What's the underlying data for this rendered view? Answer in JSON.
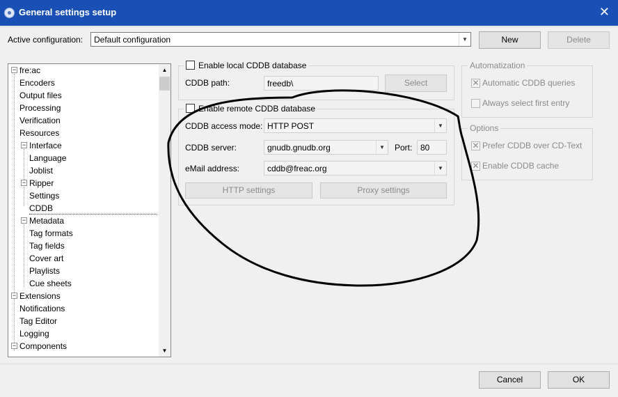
{
  "window": {
    "title": "General settings setup",
    "close_glyph": "✕",
    "icon": "freac-app-icon"
  },
  "top_bar": {
    "active_config_label": "Active configuration:",
    "active_config_value": "Default configuration",
    "new_label": "New",
    "delete_label": "Delete"
  },
  "tree": {
    "items": [
      {
        "label": "fre:ac",
        "expander": "⊟"
      },
      {
        "label": "Encoders"
      },
      {
        "label": "Output files"
      },
      {
        "label": "Processing"
      },
      {
        "label": "Verification"
      },
      {
        "label": "Resources"
      },
      {
        "label": "Interface",
        "expander": "⊟"
      },
      {
        "label": "Language"
      },
      {
        "label": "Joblist"
      },
      {
        "label": "Ripper",
        "expander": "⊟"
      },
      {
        "label": "Settings"
      },
      {
        "label": "CDDB"
      },
      {
        "label": "Metadata",
        "expander": "⊟"
      },
      {
        "label": "Tag formats"
      },
      {
        "label": "Tag fields"
      },
      {
        "label": "Cover art"
      },
      {
        "label": "Playlists"
      },
      {
        "label": "Cue sheets"
      },
      {
        "label": "Extensions",
        "expander": "⊟"
      },
      {
        "label": "Notifications"
      },
      {
        "label": "Tag Editor"
      },
      {
        "label": "Logging"
      },
      {
        "label": "Components",
        "expander": "⊟"
      }
    ],
    "selected": "CDDB"
  },
  "local_cddb": {
    "enable_label": "Enable local CDDB database",
    "path_label": "CDDB path:",
    "path_value": "freedb\\",
    "select_label": "Select"
  },
  "remote_cddb": {
    "enable_label": "Enable remote CDDB database",
    "access_mode_label": "CDDB access mode:",
    "access_mode_value": "HTTP POST",
    "server_label": "CDDB server:",
    "server_value": "gnudb.gnudb.org",
    "port_label": "Port:",
    "port_value": "80",
    "email_label": "eMail address:",
    "email_value": "cddb@freac.org",
    "http_settings_label": "HTTP settings",
    "proxy_settings_label": "Proxy settings"
  },
  "automatization": {
    "title": "Automatization",
    "auto_queries_label": "Automatic CDDB queries",
    "auto_queries_checked": true,
    "always_first_label": "Always select first entry",
    "always_first_checked": false
  },
  "options": {
    "title": "Options",
    "prefer_cddb_label": "Prefer CDDB over CD-Text",
    "prefer_cddb_checked": true,
    "cache_label": "Enable CDDB cache",
    "cache_checked": true
  },
  "footer": {
    "cancel_label": "Cancel",
    "ok_label": "OK"
  }
}
